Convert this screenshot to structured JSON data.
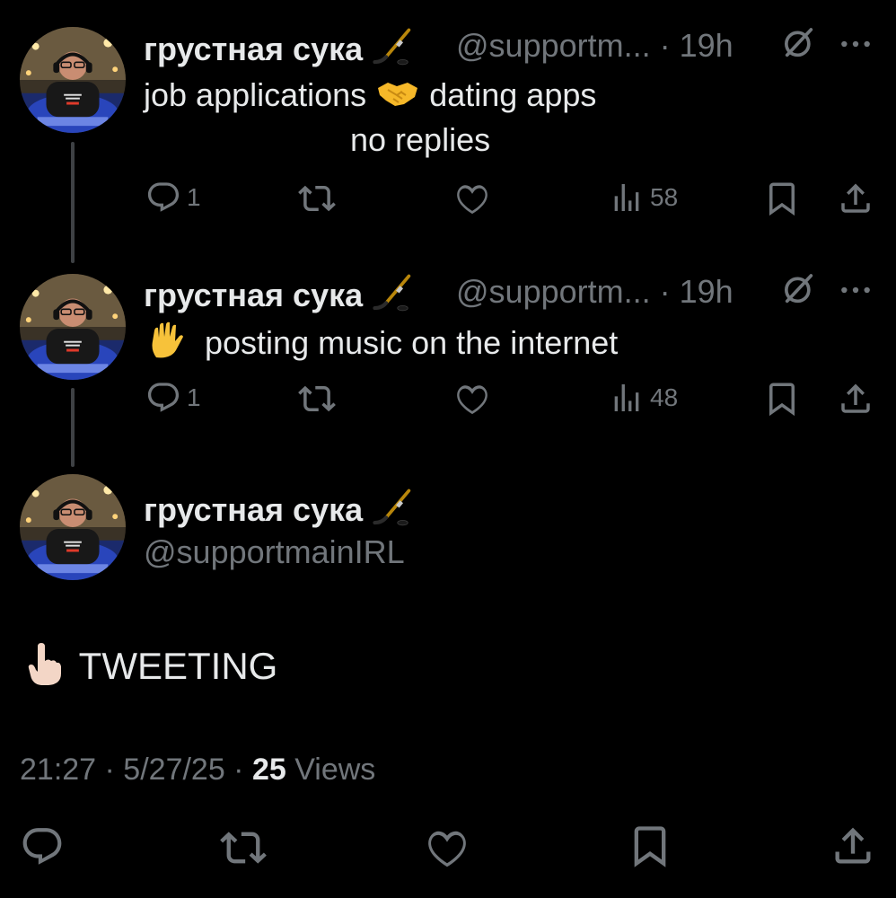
{
  "tweets": [
    {
      "display_name": "грустная сука",
      "handle_meta": "@supportm... · 19h",
      "text_line1_a": "job applications",
      "text_line1_b": "dating apps",
      "text_line2": "no replies",
      "reply_count": "1",
      "view_count": "58"
    },
    {
      "display_name": "грустная сука",
      "handle_meta": "@supportm... · 19h",
      "text": "posting music on the internet",
      "reply_count": "1",
      "view_count": "48"
    }
  ],
  "main_tweet": {
    "display_name": "грустная сука",
    "handle": "@supportmainIRL",
    "text": "TWEETING",
    "timestamp": "21:27 · 5/27/25 · ",
    "views_number": "25",
    "views_label": " Views"
  },
  "icons": {
    "name_badge": "hockey-stick-icon",
    "grok": "grok-icon",
    "more": "more-icon",
    "reply": "reply-icon",
    "retweet": "retweet-icon",
    "like": "like-icon",
    "views": "views-icon",
    "bookmark": "bookmark-icon",
    "share": "share-icon"
  },
  "colors": {
    "background": "#000000",
    "text_primary": "#e7e9ea",
    "text_secondary": "#71767b",
    "thread_line": "#3e4144"
  }
}
